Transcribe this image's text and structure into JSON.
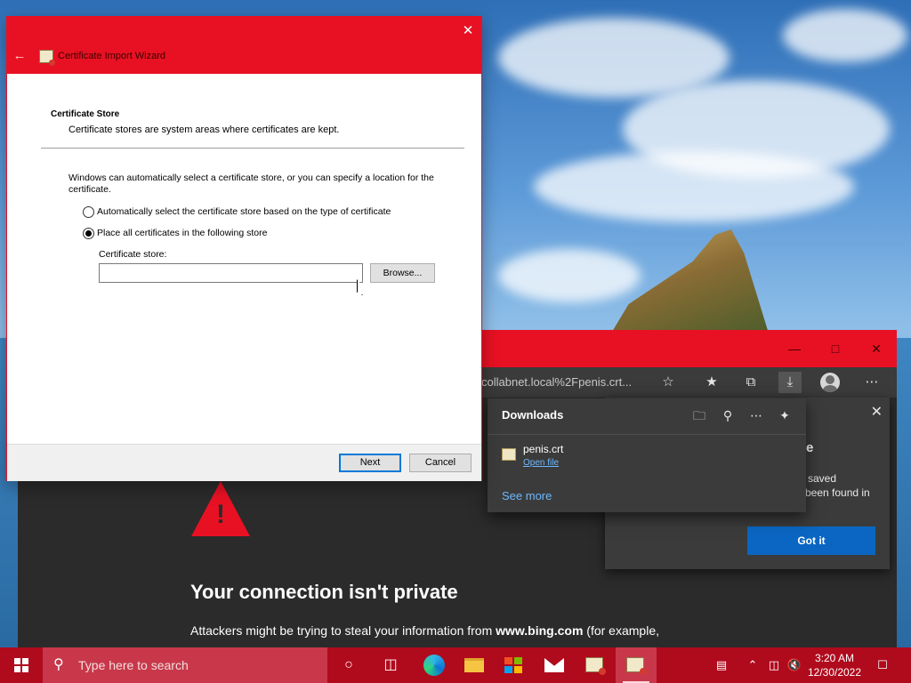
{
  "wizard": {
    "title": "Certificate Import Wizard",
    "heading": "Certificate Store",
    "subheading": "Certificate stores are system areas where certificates are kept.",
    "description": "Windows can automatically select a certificate store, or you can specify a location for the certificate.",
    "option_auto": "Automatically select the certificate store based on the type of certificate",
    "option_manual": "Place all certificates in the following store",
    "selected_option": "option_manual",
    "store_label": "Certificate store:",
    "store_value": "",
    "browse_label": "Browse...",
    "next_label": "Next",
    "cancel_label": "Cancel"
  },
  "browser": {
    "address": "collabnet.local%2Fpenis.crt...",
    "page": {
      "title": "Your connection isn't private",
      "text_prefix": "Attackers might be trying to steal your information from ",
      "text_host": "www.bing.com",
      "text_suffix": " (for example,"
    },
    "downloads": {
      "title": "Downloads",
      "file_name": "penis.crt",
      "open_file": "Open file",
      "see_more": "See more"
    },
    "tip": {
      "heading_partial": "e",
      "line1": "saved",
      "line2": "been found in",
      "button": "Got it"
    }
  },
  "taskbar": {
    "search_placeholder": "Type here to search",
    "time": "3:20 AM",
    "date": "12/30/2022"
  },
  "colors": {
    "accent": "#e81123",
    "taskbar": "#b00a1d",
    "link": "#6cb8ff",
    "primary_button": "#0a66c2"
  }
}
